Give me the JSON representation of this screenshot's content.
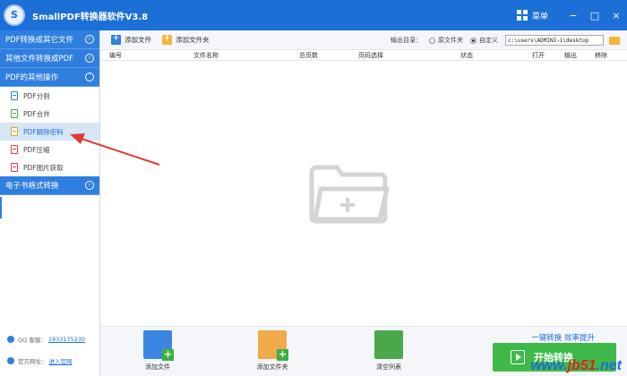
{
  "app": {
    "title": "SmallPDF转换器软件V3.8",
    "menu_label": "菜单",
    "minimize": "−",
    "maximize": "□",
    "close": "×"
  },
  "sidebar": {
    "categories": [
      {
        "label": "PDF转换成其它文件"
      },
      {
        "label": "其他文件转换成PDF"
      },
      {
        "label": "PDF的其他操作"
      },
      {
        "label": "电子书格式转换"
      }
    ],
    "items": [
      {
        "label": "PDF分割"
      },
      {
        "label": "PDF合并"
      },
      {
        "label": "PDF解除密码"
      },
      {
        "label": "PDF压缩"
      },
      {
        "label": "PDF图片获取"
      }
    ],
    "footer": {
      "qq_label": "QQ 客服：",
      "qq_value": "1933175230",
      "site_label": "官方网址：",
      "site_value": "进入官网"
    }
  },
  "toolbar": {
    "add_file": "添加文件",
    "add_folder": "添加文件夹",
    "output_dir_label": "输出目录：",
    "option_original": "原文件夹",
    "option_custom": "自定义",
    "path_value": "c:\\users\\ADMINI~1\\desktop"
  },
  "table": {
    "columns": [
      "编号",
      "文件名称",
      "总页数",
      "页码选择",
      "状态",
      "打开",
      "输出",
      "移除"
    ]
  },
  "bottom": {
    "add_file": "添加文件",
    "add_folder": "添加文件夹",
    "clear_list": "清空列表",
    "slogan": "一键转换  效率提升",
    "start": "开始转换"
  },
  "watermark": {
    "prefix": "www.",
    "domain": "jb51",
    "suffix": ".net"
  },
  "colors": {
    "brand": "#1b6fd6",
    "sidebar_category": "#2f7fe0",
    "start_button": "#3fb949",
    "annotation_arrow": "#e53935"
  }
}
